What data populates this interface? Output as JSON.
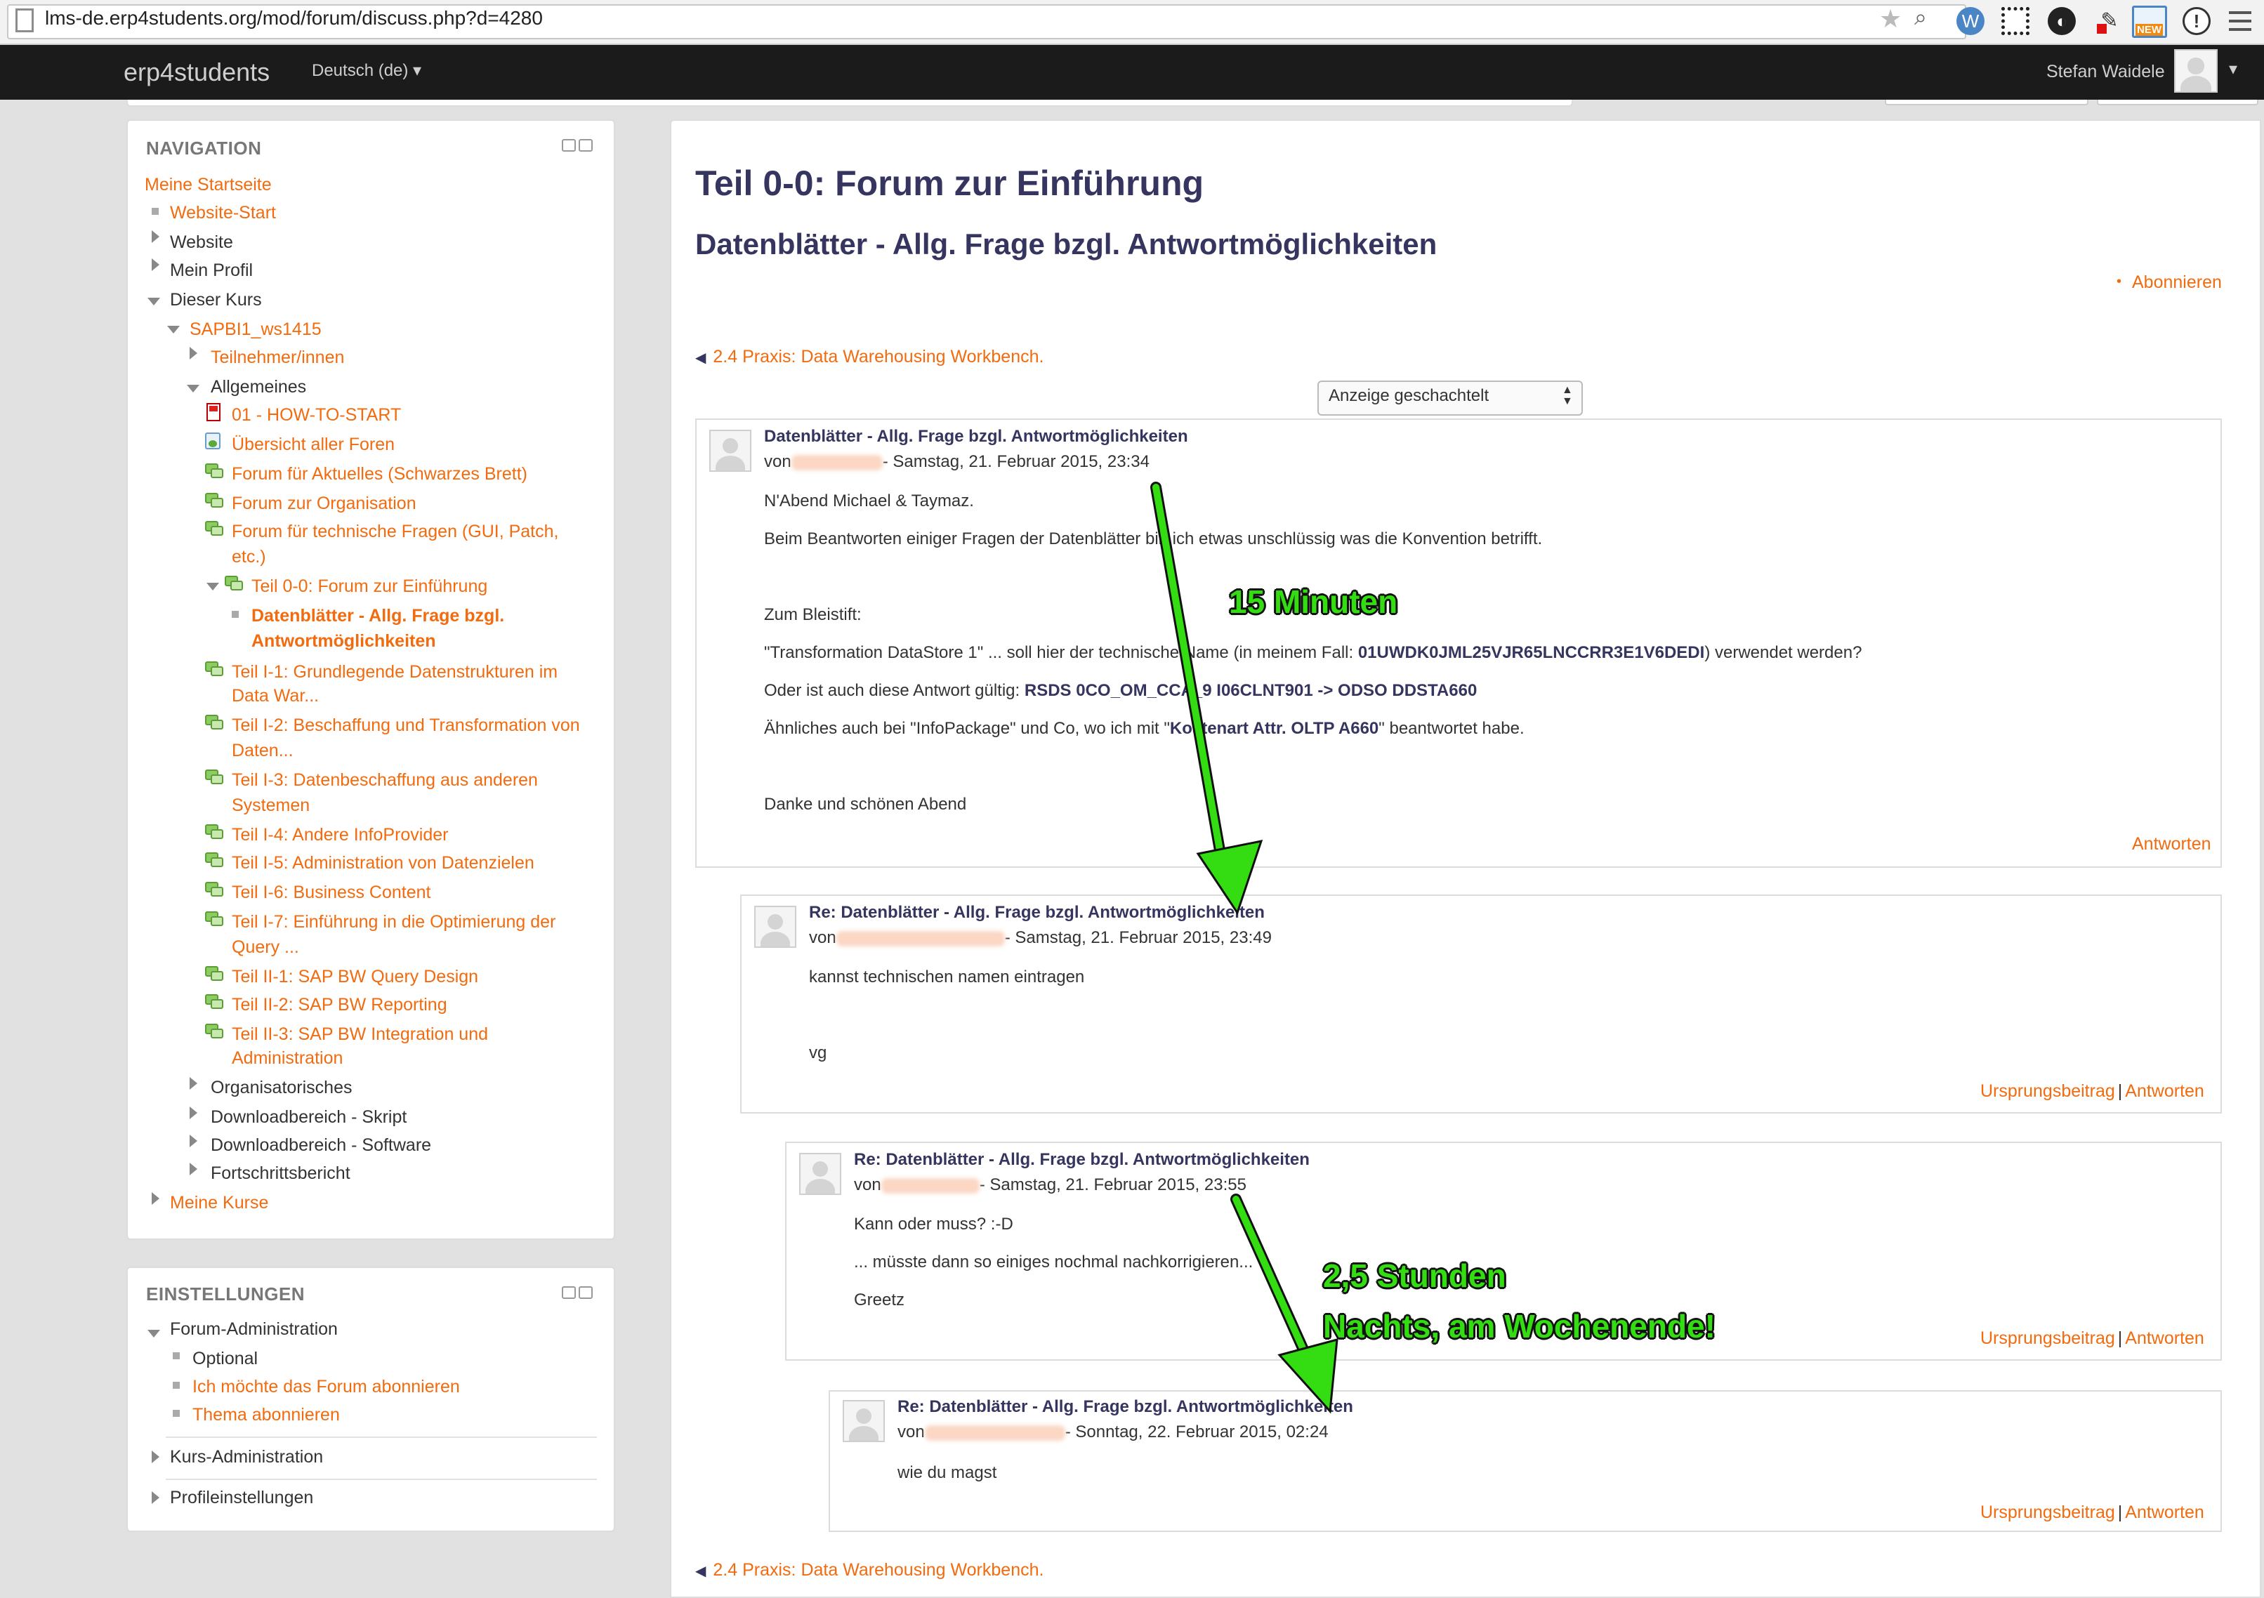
{
  "browser": {
    "url": "lms-de.erp4students.org/mod/forum/discuss.php?d=4280",
    "extension_icons": [
      "wordpress-icon",
      "qr-code-icon",
      "color-picker-icon",
      "eyedropper-icon",
      "new-badge-icon",
      "info-icon"
    ],
    "new_badge": "NEW"
  },
  "navbar": {
    "brand": "erp4students",
    "language": "Deutsch (de) ▾",
    "user_name": "Stefan Waidele",
    "user_menu_caret": "▾"
  },
  "navigation": {
    "title": "NAVIGATION",
    "items": {
      "home": "Meine Startseite",
      "site_start": "Website-Start",
      "website": "Website",
      "my_profile": "Mein Profil",
      "this_course": "Dieser Kurs",
      "course": "SAPBI1_ws1415",
      "participants": "Teilnehmer/innen",
      "general": "Allgemeines",
      "how_to_start": "01 - HOW-TO-START",
      "all_forums": "Übersicht aller Foren",
      "forum_news": "Forum für Aktuelles (Schwarzes Brett)",
      "forum_org": "Forum zur Organisation",
      "forum_tech_1": "Forum für technische Fragen (GUI, Patch,",
      "forum_tech_2": "etc.)",
      "teil00": "Teil 0-0: Forum zur Einführung",
      "current_1": "Datenblätter - Allg. Frage bzgl.",
      "current_2": "Antwortmöglichkeiten",
      "teil_i1_1": "Teil I-1: Grundlegende Datenstrukturen im",
      "teil_i1_2": "Data War...",
      "teil_i2_1": "Teil I-2: Beschaffung und Transformation von",
      "teil_i2_2": "Daten...",
      "teil_i3_1": "Teil I-3: Datenbeschaffung aus anderen",
      "teil_i3_2": "Systemen",
      "teil_i4": "Teil I-4: Andere InfoProvider",
      "teil_i5": "Teil I-5: Administration von Datenzielen",
      "teil_i6": "Teil I-6: Business Content",
      "teil_i7_1": "Teil I-7: Einführung in die Optimierung der",
      "teil_i7_2": "Query ...",
      "teil_ii1": "Teil II-1: SAP BW Query Design",
      "teil_ii2": "Teil II-2: SAP BW Reporting",
      "teil_ii3_1": "Teil II-3: SAP BW Integration und",
      "teil_ii3_2": "Administration",
      "organisatorisches": "Organisatorisches",
      "download_script": "Downloadbereich - Skript",
      "download_software": "Downloadbereich - Software",
      "progress": "Fortschrittsbericht",
      "my_courses": "Meine Kurse"
    }
  },
  "settings": {
    "title": "EINSTELLUNGEN",
    "forum_admin": "Forum-Administration",
    "optional": "Optional",
    "subscribe_forum": "Ich möchte das Forum abonnieren",
    "subscribe_topic": "Thema abonnieren",
    "course_admin": "Kurs-Administration",
    "profile_settings": "Profileinstellungen"
  },
  "main": {
    "page_title": "Teil 0-0: Forum zur Einführung",
    "discussion_title": "Datenblätter - Allg. Frage bzgl. Antwortmöglichkeiten",
    "subscribe": "Abonnieren",
    "bullet": "•",
    "prev_link": "2.4 Praxis: Data Warehousing Workbench.",
    "display_mode": "Anzeige geschachtelt",
    "posts": [
      {
        "subject": "Datenblätter - Allg. Frage bzgl. Antwortmöglichkeiten",
        "by": "von",
        "date": "- Samstag, 21. Februar 2015, 23:34",
        "lines": {
          "l1": "N'Abend Michael & Taymaz.",
          "l2": "Beim Beantworten einiger Fragen der Datenblätter bin ich etwas unschlüssig was die Konvention betrifft.",
          "l3": "Zum Bleistift:",
          "l4a": "\"Transformation DataStore 1\" ... soll hier der technische Name (in meinem Fall: ",
          "l4b": "01UWDK0JML25VJR65LNCCRR3E1V6DEDI",
          "l4c": ") verwendet werden?",
          "l5a": "Oder ist auch diese Antwort gültig: ",
          "l5b": "RSDS 0CO_OM_CCA_9 I06CLNT901 -> ODSO DDSTA660",
          "l6a": "Ähnliches auch bei \"InfoPackage\" und Co, wo ich mit \"",
          "l6b": "Kostenart Attr. OLTP A660",
          "l6c": "\" beantwortet habe.",
          "l7": "Danke und schönen Abend"
        },
        "reply": "Antworten"
      },
      {
        "subject": "Re: Datenblätter - Allg. Frage bzgl. Antwortmöglichkeiten",
        "by": "von",
        "date": "- Samstag, 21. Februar 2015, 23:49",
        "lines": {
          "l1": "kannst technischen namen eintragen",
          "l2": "vg"
        },
        "parent": "Ursprungsbeitrag",
        "sep": "|",
        "reply": "Antworten"
      },
      {
        "subject": "Re: Datenblätter - Allg. Frage bzgl. Antwortmöglichkeiten",
        "by": "von",
        "date": "- Samstag, 21. Februar 2015, 23:55",
        "lines": {
          "l1": "Kann oder muss? :-D",
          "l2": "... müsste dann so einiges nochmal nachkorrigieren...",
          "l3": "Greetz"
        },
        "parent": "Ursprungsbeitrag",
        "sep": "|",
        "reply": "Antworten"
      },
      {
        "subject": "Re: Datenblätter - Allg. Frage bzgl. Antwortmöglichkeiten",
        "by": "von",
        "date": "- Sonntag, 22. Februar 2015, 02:24",
        "lines": {
          "l1": "wie du magst"
        },
        "parent": "Ursprungsbeitrag",
        "sep": "|",
        "reply": "Antworten"
      }
    ]
  },
  "annotations": {
    "label_1": "15 Minuten",
    "label_2a": "2,5 Stunden",
    "label_2b": "Nachts, am Wochenende!",
    "color": "#33dd11"
  },
  "colors": {
    "link": "#f26b0f",
    "heading": "#35355f",
    "navbar": "#1b1b1b"
  }
}
